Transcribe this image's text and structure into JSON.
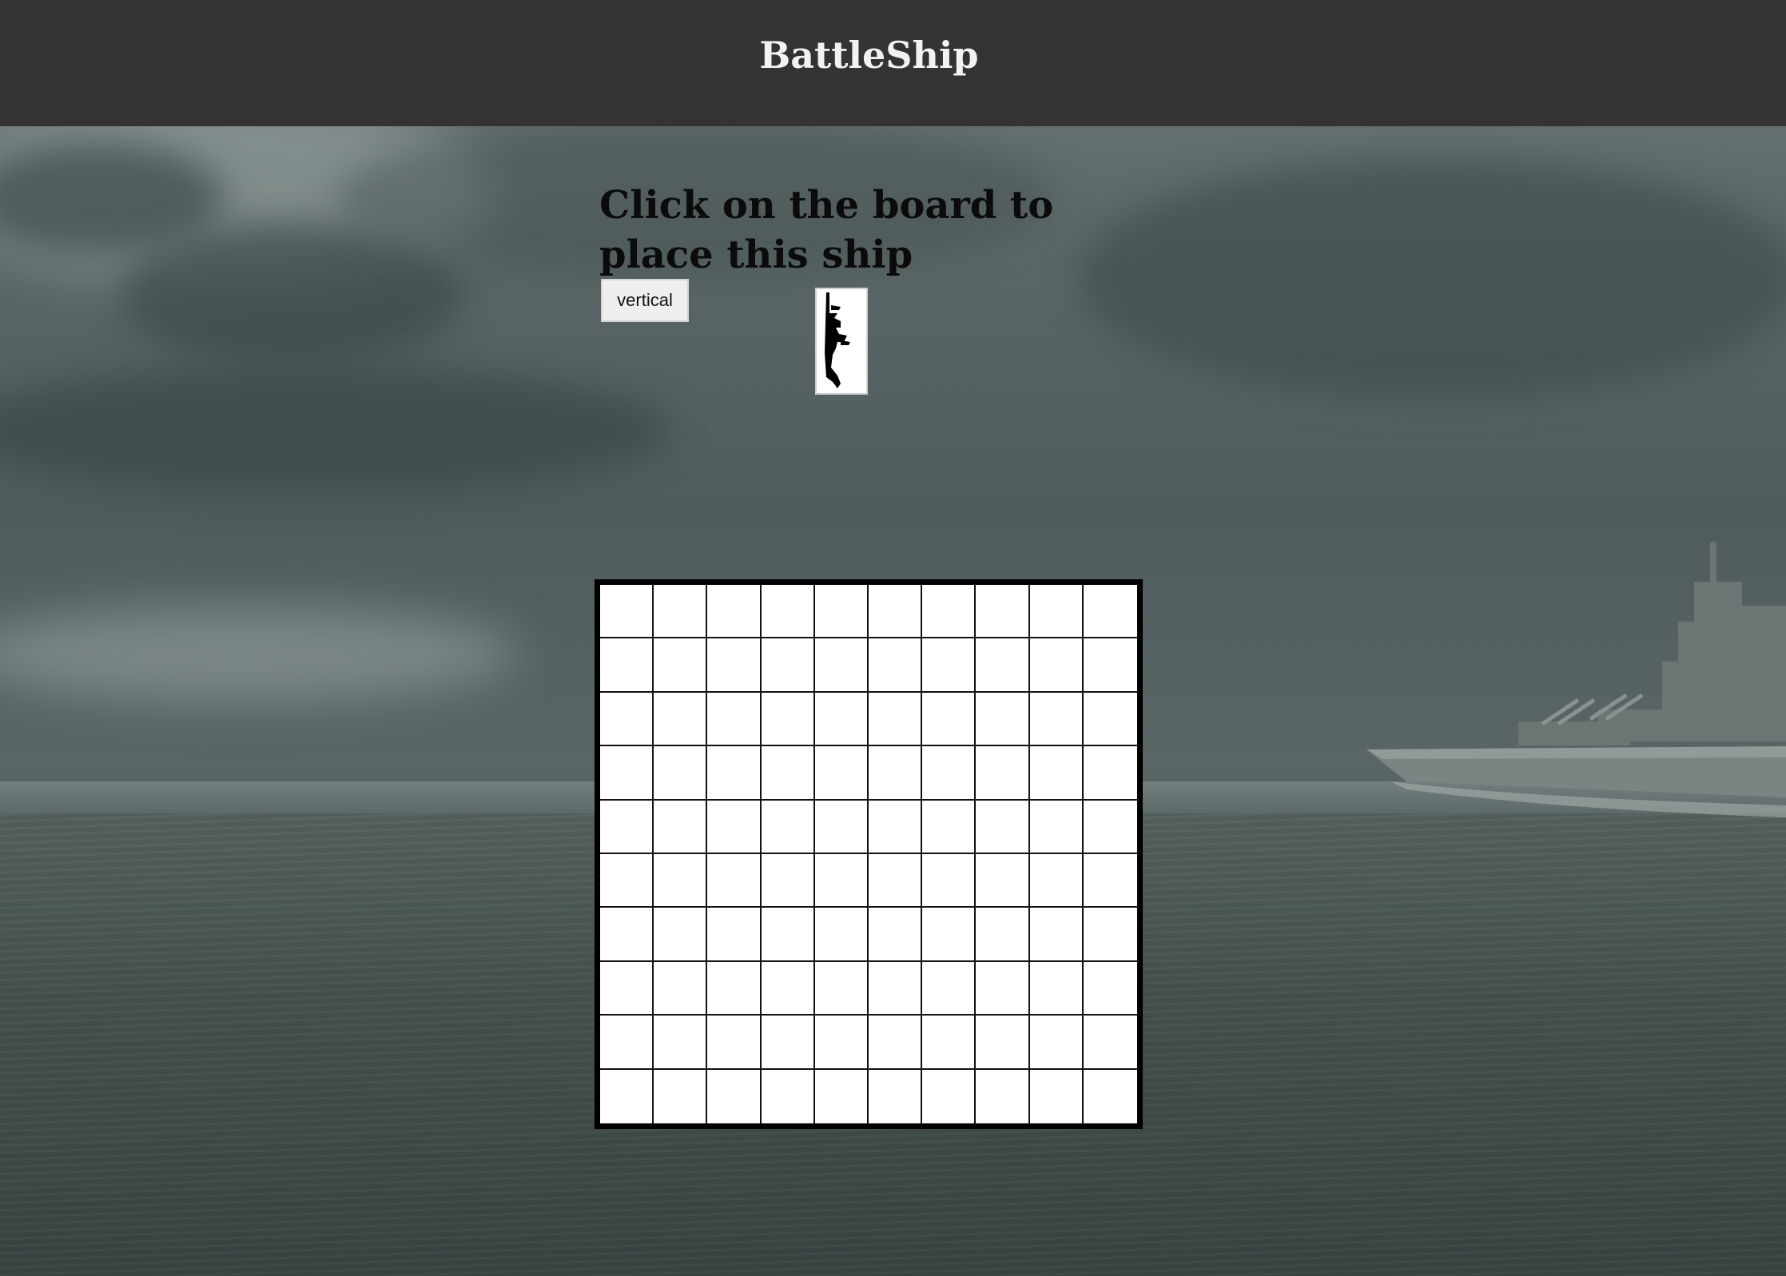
{
  "header": {
    "title": "BattleShip"
  },
  "placement": {
    "instruction": "Click on the board to place this ship",
    "orientation_label": "vertical",
    "ship_preview_icon": "ship-silhouette-icon"
  },
  "board": {
    "rows": 10,
    "columns": 10
  },
  "colors": {
    "header_bg": "#333333",
    "header_text": "#f2f2f2",
    "board_cell": "#ffffff",
    "board_border": "#000000"
  }
}
